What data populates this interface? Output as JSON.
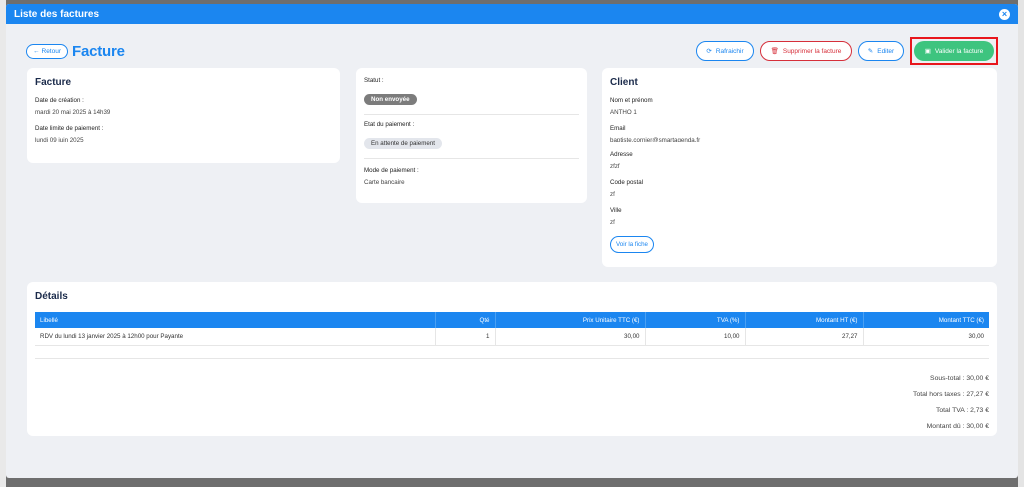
{
  "modal": {
    "title": "Liste des factures",
    "close_label": "×"
  },
  "toolbar": {
    "back_label": "Retour",
    "back_icon": "arrow-left-icon",
    "page_title": "Facture",
    "refresh_label": "Rafraichir",
    "delete_label": "Supprimer la facture",
    "edit_label": "Editer",
    "validate_label": "Valider la facture"
  },
  "facture": {
    "heading": "Facture",
    "creation_label": "Date de création :",
    "creation_value": "mardi 20 mai 2025 à 14h39",
    "limit_label": "Date limite de paiement :",
    "limit_value": "lundi 09 juin 2025"
  },
  "statut": {
    "statut_label": "Statut :",
    "statut_value": "Non envoyée",
    "payment_state_label": "Etat du paiement :",
    "payment_state_value": "En attente de paiement",
    "payment_mode_label": "Mode de paiement :",
    "payment_mode_value": "Carte bancaire"
  },
  "client": {
    "heading": "Client",
    "name_label": "Nom et prénom",
    "name_value": "ANTHO 1",
    "email_label": "Email",
    "email_value": "baptiste.cornier@smartagenda.fr",
    "address_label": "Adresse",
    "address_value": "zfzf",
    "postal_label": "Code postal",
    "postal_value": "zf",
    "city_label": "Ville",
    "city_value": "zf",
    "view_label": "Voir la fiche"
  },
  "details": {
    "heading": "Détails",
    "columns": [
      "Libellé",
      "Qté",
      "Prix Unitaire TTC (€)",
      "TVA (%)",
      "Montant HT (€)",
      "Montant TTC (€)"
    ],
    "rows": [
      [
        "RDV du lundi 13 janvier 2025 à 12h00 pour Payante",
        "1",
        "30,00",
        "10,00",
        "27,27",
        "30,00"
      ]
    ],
    "subtotal": "Sous-total : 30,00 €",
    "total_ht": "Total hors taxes : 27,27 €",
    "total_tva": "Total TVA : 2,73 €",
    "amount_due": "Montant dû : 30,00 €"
  },
  "colors": {
    "primary": "#1b86f0",
    "danger": "#d62f3a",
    "success": "#3ec47f",
    "highlight": "#e8161c"
  }
}
